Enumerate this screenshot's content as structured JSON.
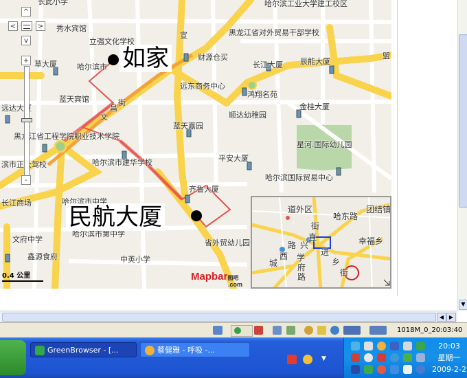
{
  "map": {
    "labels": [
      {
        "id": "changxiaoshu",
        "text": "长此小学"
      },
      {
        "id": "hgd_jiangong",
        "text": "哈尔滨工业大学建工校区"
      },
      {
        "id": "xiushui",
        "text": "秀水宾馆"
      },
      {
        "id": "liqiang",
        "text": "立强文化学校"
      },
      {
        "id": "hlj_waimao",
        "text": "黑龙江省对外贸易干部学校"
      },
      {
        "id": "caoshang",
        "text": "草大厦"
      },
      {
        "id": "harbin_shi",
        "text": "哈尔滨市"
      },
      {
        "id": "caiyuan",
        "text": "财源仓买"
      },
      {
        "id": "changjiang",
        "text": "长江大厦"
      },
      {
        "id": "chenneng",
        "text": "辰能大厦"
      },
      {
        "id": "meng",
        "text": "盟"
      },
      {
        "id": "yuandong",
        "text": "远东商务中心"
      },
      {
        "id": "hongxiang",
        "text": "鸿翔名苑"
      },
      {
        "id": "lantian_bg",
        "text": "蓝天宾馆"
      },
      {
        "id": "jie1",
        "text": "街"
      },
      {
        "id": "chang",
        "text": "昌"
      },
      {
        "id": "wen",
        "text": "文"
      },
      {
        "id": "shunda",
        "text": "顺达幼稚园"
      },
      {
        "id": "jingui",
        "text": "金桂大厦"
      },
      {
        "id": "yuanda",
        "text": "远达大厦"
      },
      {
        "id": "lantian_jy",
        "text": "蓝天嘉园"
      },
      {
        "id": "xinghe",
        "text": "星河.国际幼儿园"
      },
      {
        "id": "hlj_gongcheng",
        "text": "黑龙江省工程学院职业技术学院"
      },
      {
        "id": "pingan",
        "text": "平安大厦"
      },
      {
        "id": "hrb_jianhua",
        "text": "哈尔滨市建华学校"
      },
      {
        "id": "bin_jiaxiao",
        "text": "滨市正大驾校"
      },
      {
        "id": "hrb_guomao",
        "text": "哈尔滨国际贸易中心"
      },
      {
        "id": "qilu",
        "text": "齐鲁大厦"
      },
      {
        "id": "changcheng",
        "text": "长江商场"
      },
      {
        "id": "hrb_zhongxue",
        "text": "哈尔滨市中学"
      },
      {
        "id": "hrb_shifan",
        "text": "哈尔滨市第中学"
      },
      {
        "id": "wenhua",
        "text": "文府中学"
      },
      {
        "id": "waiwei",
        "text": "省外贸幼儿园"
      },
      {
        "id": "lvyuan",
        "text": "鑫源食府"
      },
      {
        "id": "zhongying",
        "text": "中英小学"
      },
      {
        "id": "xuan",
        "text": "宣"
      }
    ],
    "callout_1": "如家",
    "callout_2": "民航大厦",
    "scale": "0.4 公里",
    "brand": "Mapbar",
    "brand_cn": "图吧",
    "brand_com": ".com",
    "controls": {
      "up": "^",
      "left": "<",
      "center": "",
      "right": ">",
      "down": "v",
      "zoom_in": "+",
      "zoom_out": "-"
    }
  },
  "minimap": {
    "labels": [
      {
        "id": "daowai",
        "text": "道外区"
      },
      {
        "id": "tuanjie",
        "text": "团结镇"
      },
      {
        "id": "jie_a",
        "text": "街"
      },
      {
        "id": "hadong",
        "text": "哈东路"
      },
      {
        "id": "zhi",
        "text": "直"
      },
      {
        "id": "lu",
        "text": "路"
      },
      {
        "id": "xing",
        "text": "兴"
      },
      {
        "id": "xingfu",
        "text": "幸福乡"
      },
      {
        "id": "cheng",
        "text": "城"
      },
      {
        "id": "xi",
        "text": "西"
      },
      {
        "id": "xue",
        "text": "学"
      },
      {
        "id": "jin",
        "text": "进"
      },
      {
        "id": "xiang",
        "text": "乡"
      },
      {
        "id": "fu",
        "text": "府"
      },
      {
        "id": "lu2",
        "text": "路"
      },
      {
        "id": "jie_b",
        "text": "街"
      }
    ]
  },
  "statusbar": {
    "speed": "1018M_0_20:03:40"
  },
  "taskbar": {
    "tasks": [
      {
        "id": "greenbrowser",
        "label": "GreenBrowser - [..."
      },
      {
        "id": "music",
        "label": "蔡健雅 - 呼吸 -..."
      }
    ],
    "clock": {
      "time": "20:03",
      "weekday": "星期一",
      "date": "2009-2-2"
    }
  },
  "colors": {
    "route": "#e8534d",
    "road_major": "#f9d34b",
    "road_minor": "#ffffff",
    "taskbar": "#245edb",
    "tray": "#1790e8"
  }
}
